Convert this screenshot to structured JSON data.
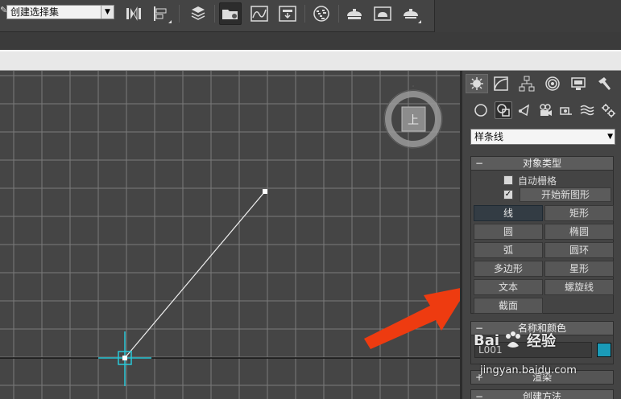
{
  "toolbar": {
    "selection_set": "创建选择集",
    "buttons": [
      "mirror-icon",
      "align-icon",
      "layer-manager-icon",
      "scene-explorer-icon",
      "curve-editor-icon",
      "schematic-view-icon",
      "material-editor-icon",
      "render-setup-icon",
      "render-frame-icon",
      "render-production-icon"
    ]
  },
  "command_panel": {
    "tabs": [
      "create",
      "modify",
      "hierarchy",
      "motion",
      "display",
      "utilities"
    ],
    "categories": [
      "geometry",
      "shapes",
      "lights",
      "cameras",
      "helpers",
      "space-warps",
      "systems"
    ],
    "type_select": "样条线",
    "object_type": {
      "title": "对象类型",
      "auto_grid": "自动栅格",
      "start_new_shape": "开始新图形",
      "buttons": [
        "线",
        "矩形",
        "圆",
        "椭圆",
        "弧",
        "圆环",
        "多边形",
        "星形",
        "文本",
        "螺旋线",
        "截面"
      ]
    },
    "name_color": {
      "title": "名称和颜色",
      "name_value": "L001",
      "color": "#1a9bb8"
    },
    "rollout_render": "渲染",
    "rollout_creation": "创建方法"
  },
  "viewcube": {
    "face_label": "上"
  },
  "watermark": {
    "brand": "Bai",
    "brand_cn": "经验",
    "url": "jingyan.baidu.com"
  },
  "colors": {
    "grid": "#7a7a7a",
    "active_button": "#333c44",
    "arrow": "#ee3b10",
    "cursor": "#29c8d8"
  }
}
